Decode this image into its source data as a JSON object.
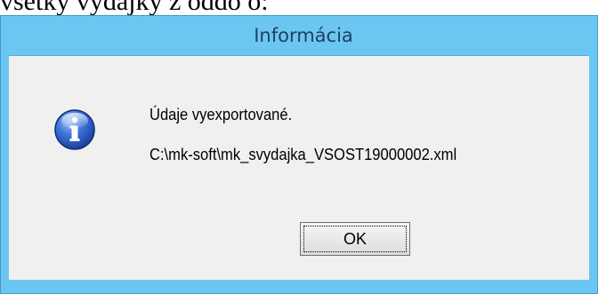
{
  "background": {
    "text": "všetky výdajky z oddo o:"
  },
  "dialog": {
    "title": "Informácia",
    "icon": "info-icon",
    "message_line1": "Údaje vyexportované.",
    "message_line2": "C:\\mk-soft\\mk_svydajka_VSOST19000002.xml",
    "ok_label": "OK"
  },
  "colors": {
    "frame": "#6cc6f2",
    "client": "#f0f0f0",
    "title_text": "#1f3f5e",
    "icon_blue": "#2c5fc0"
  }
}
